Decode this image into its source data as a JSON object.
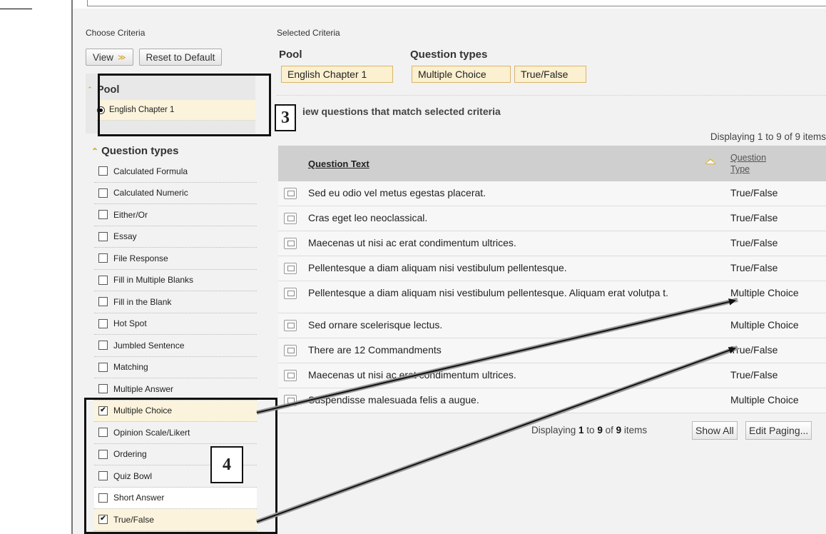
{
  "left": {
    "header": "Choose Criteria",
    "view_label": "View",
    "reset_label": "Reset to Default",
    "pool_title": "Pool",
    "pool_item": "English Chapter 1",
    "types_title": "Question types",
    "types": [
      {
        "label": "Calculated Formula",
        "checked": false
      },
      {
        "label": "Calculated Numeric",
        "checked": false
      },
      {
        "label": "Either/Or",
        "checked": false
      },
      {
        "label": "Essay",
        "checked": false
      },
      {
        "label": "File Response",
        "checked": false
      },
      {
        "label": "Fill in Multiple Blanks",
        "checked": false
      },
      {
        "label": "Fill in the Blank",
        "checked": false
      },
      {
        "label": "Hot Spot",
        "checked": false
      },
      {
        "label": "Jumbled Sentence",
        "checked": false
      },
      {
        "label": "Matching",
        "checked": false
      },
      {
        "label": "Multiple Answer",
        "checked": false
      },
      {
        "label": "Multiple Choice",
        "checked": true
      },
      {
        "label": "Opinion Scale/Likert",
        "checked": false
      },
      {
        "label": "Ordering",
        "checked": false
      },
      {
        "label": "Quiz Bowl",
        "checked": false
      },
      {
        "label": "Short Answer",
        "checked": false
      },
      {
        "label": "True/False",
        "checked": true
      }
    ]
  },
  "right": {
    "header": "Selected Criteria",
    "pool_label": "Pool",
    "types_label": "Question types",
    "chip_pool": "English Chapter 1",
    "chip_mc": "Multiple Choice",
    "chip_tf": "True/False",
    "view_questions": "iew questions that match selected criteria",
    "displaying_top": "Displaying 1 to 9 of 9 items",
    "col_text": "Question Text",
    "col_type_1": "Question",
    "col_type_2": "Type",
    "rows": [
      {
        "text": "Sed eu odio vel metus egestas placerat.",
        "type": "True/False"
      },
      {
        "text": "Cras eget leo neoclassical.",
        "type": "True/False"
      },
      {
        "text": "Maecenas ut nisi ac erat condimentum ultrices.",
        "type": "True/False"
      },
      {
        "text": "Pellentesque a diam aliquam nisi vestibulum pellentesque.",
        "type": "True/False"
      },
      {
        "text": "Pellentesque a diam aliquam nisi vestibulum pellentesque. Aliquam erat volutpa t.",
        "type": "Multiple Choice"
      },
      {
        "text": "Sed ornare scelerisque lectus.",
        "type": "Multiple Choice"
      },
      {
        "text": "There are 12 Commandments",
        "type": "True/False"
      },
      {
        "text": " Maecenas ut nisi ac erat condimentum ultrices.",
        "type": "True/False"
      },
      {
        "text": "Suspendisse malesuada felis a augue.",
        "type": "Multiple Choice"
      }
    ],
    "footer_prefix": "Displaying ",
    "footer_from": "1",
    "footer_mid1": " to ",
    "footer_to": "9",
    "footer_mid2": " of ",
    "footer_total": "9",
    "footer_suffix": " items",
    "show_all": "Show All",
    "edit_paging": "Edit Paging..."
  },
  "callouts": {
    "three": "3",
    "four": "4"
  }
}
